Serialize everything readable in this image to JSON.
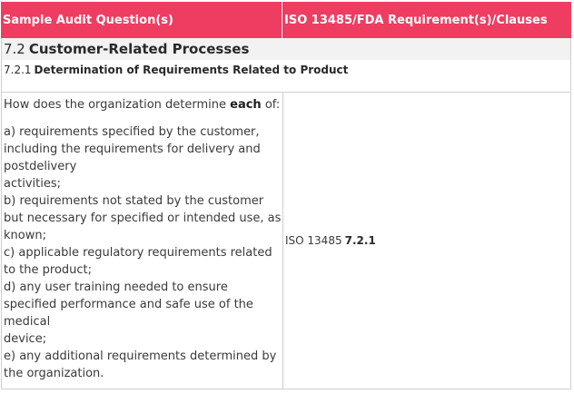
{
  "table": {
    "header": {
      "col1": "Sample Audit Question(s)",
      "col2": "ISO 13485/FDA Requirement(s)/Clauses"
    },
    "section": {
      "number": "7.2",
      "title": "Customer-Related Processes"
    },
    "subsection": {
      "number": "7.2.1",
      "title": "Determination of Requirements Related to Product"
    },
    "question": {
      "intro_before": "How does the organization determine ",
      "intro_bold": "each",
      "intro_after": " of:",
      "lines": [
        "a) requirements specified by the customer,",
        "including the requirements for delivery and",
        "postdelivery",
        "activities;",
        "b) requirements not stated by the customer",
        "but necessary for specified or intended use, as",
        "known;",
        "c) applicable regulatory requirements related",
        "to the product;",
        "d) any user training needed to ensure",
        "specified performance and safe use of the",
        "medical",
        "device;",
        "e) any additional requirements determined by",
        "the organization."
      ]
    },
    "requirement": {
      "prefix": "ISO 13485",
      "clause": "7.2.1"
    }
  },
  "colors": {
    "header_bg": "#ef3d61",
    "header_text": "#ffffff",
    "section_bg": "#f2f2f2",
    "border": "#cfcfcf"
  }
}
